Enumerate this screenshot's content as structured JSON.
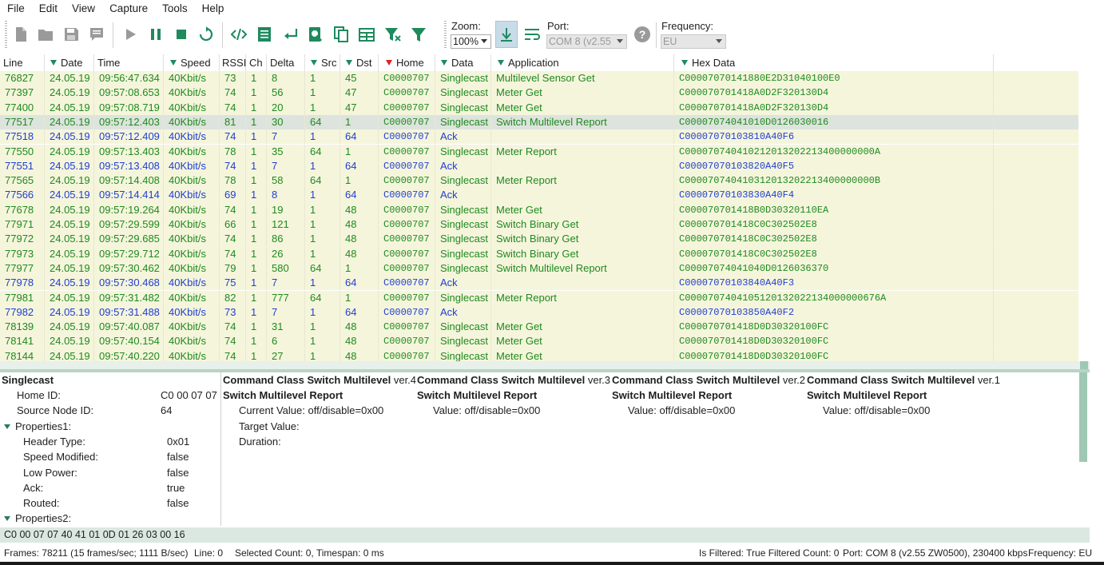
{
  "menu": [
    "File",
    "Edit",
    "View",
    "Capture",
    "Tools",
    "Help"
  ],
  "toolbar": {
    "zoom_label": "Zoom:",
    "zoom_value": "100%",
    "port_label": "Port:",
    "port_value": "COM 8 (v2.55",
    "freq_label": "Frequency:",
    "freq_value": "EU"
  },
  "columns": {
    "line": "Line",
    "date": "Date",
    "time": "Time",
    "speed": "Speed",
    "rssi": "RSSI",
    "ch": "Ch",
    "delta": "Delta",
    "src": "Src",
    "dst": "Dst",
    "home": "Home",
    "data": "Data",
    "application": "Application",
    "hex": "Hex Data"
  },
  "rows": [
    {
      "line": "76827",
      "date": "24.05.19",
      "time": "09:56:47.634",
      "speed": "40Kbit/s",
      "rssi": "73",
      "ch": "1",
      "delta": "8",
      "src": "1",
      "dst": "45",
      "home": "C0000707",
      "data": "Singlecast",
      "app": "Multilevel Sensor Get",
      "hex": "C00007070141880E2D31040100E0",
      "kind": "green"
    },
    {
      "line": "77397",
      "date": "24.05.19",
      "time": "09:57:08.653",
      "speed": "40Kbit/s",
      "rssi": "74",
      "ch": "1",
      "delta": "56",
      "src": "1",
      "dst": "47",
      "home": "C0000707",
      "data": "Singlecast",
      "app": "Meter Get",
      "hex": "C000070701418A0D2F320130D4",
      "kind": "green"
    },
    {
      "line": "77400",
      "date": "24.05.19",
      "time": "09:57:08.719",
      "speed": "40Kbit/s",
      "rssi": "74",
      "ch": "1",
      "delta": "20",
      "src": "1",
      "dst": "47",
      "home": "C0000707",
      "data": "Singlecast",
      "app": "Meter Get",
      "hex": "C000070701418A0D2F320130D4",
      "kind": "green"
    },
    {
      "line": "77517",
      "date": "24.05.19",
      "time": "09:57:12.403",
      "speed": "40Kbit/s",
      "rssi": "81",
      "ch": "1",
      "delta": "30",
      "src": "64",
      "dst": "1",
      "home": "C0000707",
      "data": "Singlecast",
      "app": "Switch Multilevel Report",
      "hex": "C00007074041010D0126030016",
      "kind": "green",
      "sel": true
    },
    {
      "line": "77518",
      "date": "24.05.19",
      "time": "09:57:12.409",
      "speed": "40Kbit/s",
      "rssi": "74",
      "ch": "1",
      "delta": "7",
      "src": "1",
      "dst": "64",
      "home": "C0000707",
      "data": "Ack",
      "app": "",
      "hex": "C00007070103810A40F6",
      "kind": "blue"
    },
    {
      "line": "77550",
      "date": "24.05.19",
      "time": "09:57:13.403",
      "speed": "40Kbit/s",
      "rssi": "78",
      "ch": "1",
      "delta": "35",
      "src": "64",
      "dst": "1",
      "home": "C0000707",
      "data": "Singlecast",
      "app": "Meter Report",
      "hex": "C000070740410212013202213400000000A",
      "kind": "green"
    },
    {
      "line": "77551",
      "date": "24.05.19",
      "time": "09:57:13.408",
      "speed": "40Kbit/s",
      "rssi": "74",
      "ch": "1",
      "delta": "7",
      "src": "1",
      "dst": "64",
      "home": "C0000707",
      "data": "Ack",
      "app": "",
      "hex": "C00007070103820A40F5",
      "kind": "blue"
    },
    {
      "line": "77565",
      "date": "24.05.19",
      "time": "09:57:14.408",
      "speed": "40Kbit/s",
      "rssi": "78",
      "ch": "1",
      "delta": "58",
      "src": "64",
      "dst": "1",
      "home": "C0000707",
      "data": "Singlecast",
      "app": "Meter Report",
      "hex": "C000070740410312013202213400000000B",
      "kind": "green"
    },
    {
      "line": "77566",
      "date": "24.05.19",
      "time": "09:57:14.414",
      "speed": "40Kbit/s",
      "rssi": "69",
      "ch": "1",
      "delta": "8",
      "src": "1",
      "dst": "64",
      "home": "C0000707",
      "data": "Ack",
      "app": "",
      "hex": "C00007070103830A40F4",
      "kind": "blue"
    },
    {
      "line": "77678",
      "date": "24.05.19",
      "time": "09:57:19.264",
      "speed": "40Kbit/s",
      "rssi": "74",
      "ch": "1",
      "delta": "19",
      "src": "1",
      "dst": "48",
      "home": "C0000707",
      "data": "Singlecast",
      "app": "Meter Get",
      "hex": "C000070701418B0D30320110EA",
      "kind": "green"
    },
    {
      "line": "77971",
      "date": "24.05.19",
      "time": "09:57:29.599",
      "speed": "40Kbit/s",
      "rssi": "66",
      "ch": "1",
      "delta": "121",
      "src": "1",
      "dst": "48",
      "home": "C0000707",
      "data": "Singlecast",
      "app": "Switch Binary Get",
      "hex": "C000070701418C0C302502E8",
      "kind": "green"
    },
    {
      "line": "77972",
      "date": "24.05.19",
      "time": "09:57:29.685",
      "speed": "40Kbit/s",
      "rssi": "74",
      "ch": "1",
      "delta": "86",
      "src": "1",
      "dst": "48",
      "home": "C0000707",
      "data": "Singlecast",
      "app": "Switch Binary Get",
      "hex": "C000070701418C0C302502E8",
      "kind": "green"
    },
    {
      "line": "77973",
      "date": "24.05.19",
      "time": "09:57:29.712",
      "speed": "40Kbit/s",
      "rssi": "74",
      "ch": "1",
      "delta": "26",
      "src": "1",
      "dst": "48",
      "home": "C0000707",
      "data": "Singlecast",
      "app": "Switch Binary Get",
      "hex": "C000070701418C0C302502E8",
      "kind": "green"
    },
    {
      "line": "77977",
      "date": "24.05.19",
      "time": "09:57:30.462",
      "speed": "40Kbit/s",
      "rssi": "79",
      "ch": "1",
      "delta": "580",
      "src": "64",
      "dst": "1",
      "home": "C0000707",
      "data": "Singlecast",
      "app": "Switch Multilevel Report",
      "hex": "C00007074041040D0126036370",
      "kind": "green"
    },
    {
      "line": "77978",
      "date": "24.05.19",
      "time": "09:57:30.468",
      "speed": "40Kbit/s",
      "rssi": "75",
      "ch": "1",
      "delta": "7",
      "src": "1",
      "dst": "64",
      "home": "C0000707",
      "data": "Ack",
      "app": "",
      "hex": "C00007070103840A40F3",
      "kind": "blue"
    },
    {
      "line": "77981",
      "date": "24.05.19",
      "time": "09:57:31.482",
      "speed": "40Kbit/s",
      "rssi": "82",
      "ch": "1",
      "delta": "777",
      "src": "64",
      "dst": "1",
      "home": "C0000707",
      "data": "Singlecast",
      "app": "Meter Report",
      "hex": "C0000707404105120132022134000000676A",
      "kind": "green"
    },
    {
      "line": "77982",
      "date": "24.05.19",
      "time": "09:57:31.488",
      "speed": "40Kbit/s",
      "rssi": "73",
      "ch": "1",
      "delta": "7",
      "src": "1",
      "dst": "64",
      "home": "C0000707",
      "data": "Ack",
      "app": "",
      "hex": "C00007070103850A40F2",
      "kind": "blue"
    },
    {
      "line": "78139",
      "date": "24.05.19",
      "time": "09:57:40.087",
      "speed": "40Kbit/s",
      "rssi": "74",
      "ch": "1",
      "delta": "31",
      "src": "1",
      "dst": "48",
      "home": "C0000707",
      "data": "Singlecast",
      "app": "Meter Get",
      "hex": "C000070701418D0D30320100FC",
      "kind": "green"
    },
    {
      "line": "78141",
      "date": "24.05.19",
      "time": "09:57:40.154",
      "speed": "40Kbit/s",
      "rssi": "74",
      "ch": "1",
      "delta": "6",
      "src": "1",
      "dst": "48",
      "home": "C0000707",
      "data": "Singlecast",
      "app": "Meter Get",
      "hex": "C000070701418D0D30320100FC",
      "kind": "green"
    },
    {
      "line": "78144",
      "date": "24.05.19",
      "time": "09:57:40.220",
      "speed": "40Kbit/s",
      "rssi": "74",
      "ch": "1",
      "delta": "27",
      "src": "1",
      "dst": "48",
      "home": "C0000707",
      "data": "Singlecast",
      "app": "Meter Get",
      "hex": "C000070701418D0D30320100FC",
      "kind": "green"
    }
  ],
  "details": {
    "title": "Singlecast",
    "home_id_label": "Home ID:",
    "home_id": "C0 00 07 07",
    "source_label": "Source Node ID:",
    "source": "64",
    "props1": "Properties1:",
    "header_type_label": "Header Type:",
    "header_type": "0x01",
    "speed_mod_label": "Speed Modified:",
    "speed_mod": "false",
    "low_power_label": "Low Power:",
    "low_power": "false",
    "ack_label": "Ack:",
    "ack": "true",
    "routed_label": "Routed:",
    "routed": "false",
    "props2": "Properties2:"
  },
  "commands": [
    {
      "title": "Command Class Switch Multilevel",
      "ver": "ver.4",
      "report": "Switch Multilevel Report",
      "lines": [
        "Current Value: off/disable=0x00",
        "Target Value:",
        "Duration:"
      ]
    },
    {
      "title": "Command Class Switch Multilevel",
      "ver": "ver.3",
      "report": "Switch Multilevel Report",
      "lines": [
        "Value: off/disable=0x00"
      ]
    },
    {
      "title": "Command Class Switch Multilevel",
      "ver": "ver.2",
      "report": "Switch Multilevel Report",
      "lines": [
        "Value: off/disable=0x00"
      ]
    },
    {
      "title": "Command Class Switch Multilevel",
      "ver": "ver.1",
      "report": "Switch Multilevel Report",
      "lines": [
        "Value: off/disable=0x00"
      ]
    }
  ],
  "hexline": "C0 00 07 07 40 41 01 0D 01 26 03 00 16",
  "status": {
    "frames": "Frames: 78211 (15 frames/sec; 1111 B/sec)",
    "line": "Line: 0",
    "selected": "Selected Count: 0, Timespan: 0 ms",
    "filtered": "Is Filtered: True Filtered Count: 0",
    "port": "Port: COM 8 (v2.55 ZW0500), 230400 kbps",
    "frequency": "Frequency: EU"
  }
}
